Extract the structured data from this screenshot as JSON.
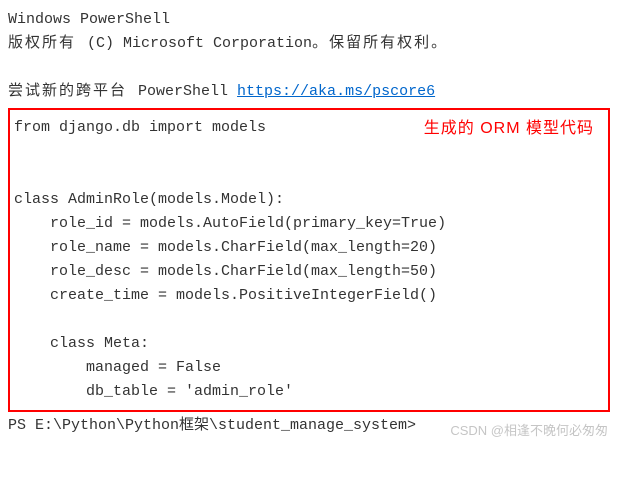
{
  "header": {
    "title": "Windows PowerShell",
    "copyright_pre": "版权所有 ",
    "copyright_mid": "(C) Microsoft Corporation",
    "copyright_post": "。保留所有权利。",
    "try_pre": "尝试新的跨平台 ",
    "try_mid": "PowerShell ",
    "link_text": "https://aka.ms/pscore6",
    "link_href": "https://aka.ms/pscore6"
  },
  "code": {
    "annotation": "生成的 ORM 模型代码",
    "line1": "from django.db import models",
    "line2": "class AdminRole(models.Model):",
    "line3": "role_id = models.AutoField(primary_key=True)",
    "line4": "role_name = models.CharField(max_length=20)",
    "line5": "role_desc = models.CharField(max_length=50)",
    "line6": "create_time = models.PositiveIntegerField()",
    "line7": "class Meta:",
    "line8": "managed = False",
    "line9": "db_table = 'admin_role'"
  },
  "prompt": "PS E:\\Python\\Python框架\\student_manage_system>",
  "watermark": "CSDN @相逢不晚何必匆匆"
}
